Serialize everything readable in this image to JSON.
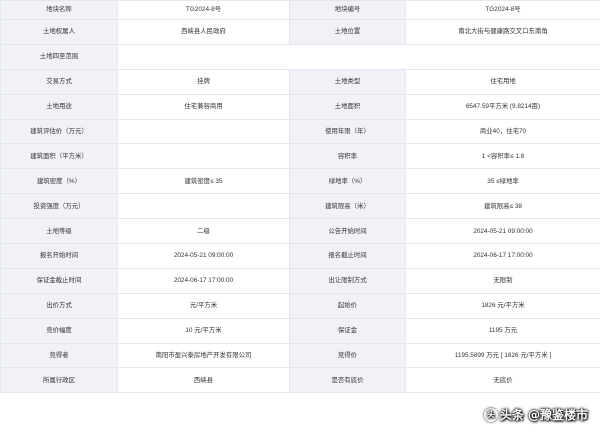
{
  "rows": [
    [
      "地块名称",
      "TG2024-8号",
      "地块编号",
      "TG2024-8号"
    ],
    [
      "土地权属人",
      "西峡县人民政府",
      "土地位置",
      "南北大街与健康路交叉口东南角"
    ],
    [
      "土地四至范围",
      "",
      "",
      ""
    ],
    [
      "交易方式",
      "挂牌",
      "土地类型",
      "住宅用地"
    ],
    [
      "土地用途",
      "住宅兼容商用",
      "土地面积",
      "6547.59平方米 (9.8214亩)"
    ],
    [
      "建筑评估价（万元）",
      "",
      "使用年限（年）",
      "商业40，住宅70"
    ],
    [
      "建筑面积（平方米）",
      "",
      "容积率",
      "1 <容积率≤ 1.8"
    ],
    [
      "建筑密度（%）",
      "建筑密度≤ 35",
      "绿地率（%）",
      "35 ≤绿地率"
    ],
    [
      "投资强度（万元）",
      "",
      "建筑限高（米）",
      "建筑限高≤ 38"
    ],
    [
      "土地等级",
      "二级",
      "公告开始时间",
      "2024-05-21 09:00:00"
    ],
    [
      "报名开始时间",
      "2024-05-21 09:00:00",
      "报名截止时间",
      "2024-06-17 17:00:00"
    ],
    [
      "保证金截止时间",
      "2024-06-17 17:00:00",
      "出让限制方式",
      "无限制"
    ],
    [
      "出价方式",
      "元/平方米",
      "起始价",
      "1826 元/平方米"
    ],
    [
      "竞价幅度",
      "10 元/平方米",
      "保证金",
      "1195 万元"
    ],
    [
      "竞得者",
      "南阳市盈兴泰房地产开发有限公司",
      "竞得价",
      "1195.5899 万元 [ 1826 元/平方米 ]"
    ],
    [
      "所属行政区",
      "西峡县",
      "是否有底价",
      "无底价"
    ]
  ],
  "watermark": {
    "logo_glyph": "头",
    "text": "头条 @豫鉴楼市"
  }
}
